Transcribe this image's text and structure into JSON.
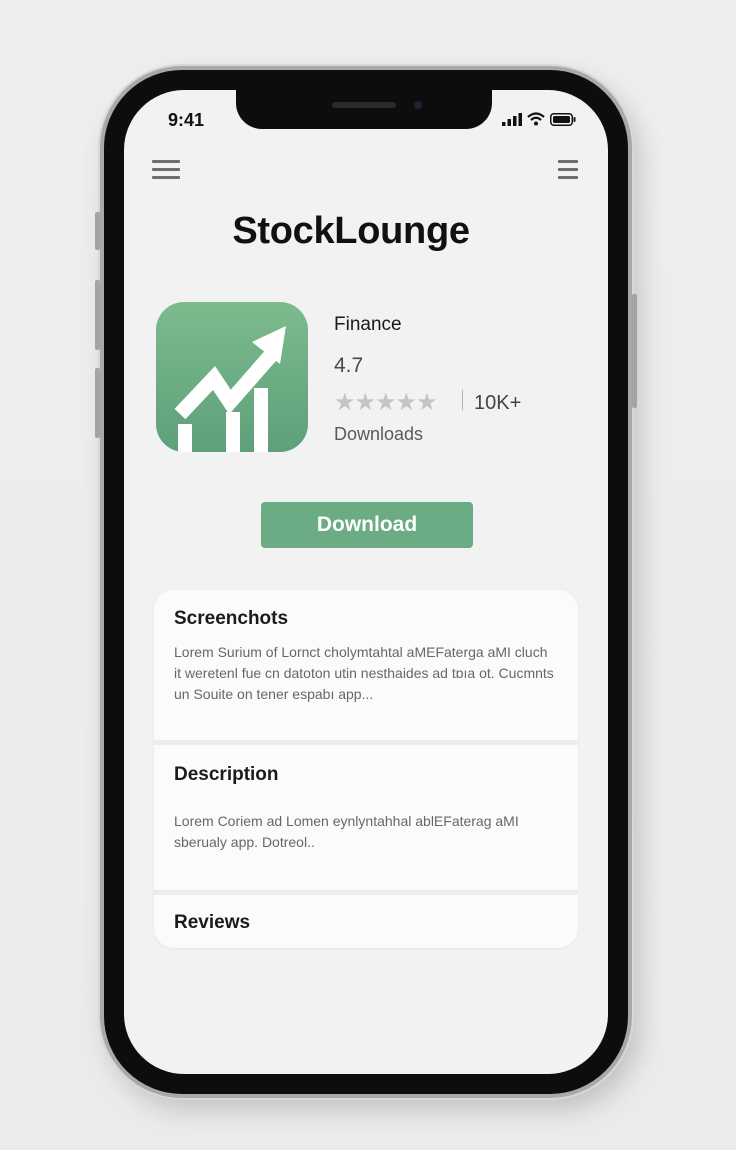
{
  "status_bar": {
    "time": "9:41"
  },
  "app": {
    "name": "StockLounge",
    "category": "Finance",
    "rating": "4.7",
    "stars_filled": 0,
    "stars_total": 5,
    "downloads_count": "10K+",
    "downloads_label": "Downloads",
    "download_button": "Download"
  },
  "sections": {
    "screenshots": {
      "title": "Screenchots",
      "body": "Lorem Surium of Lornct cholymtahtal aMEFaterga aMI cluch it weretenl fue cn datoton utin nesthaides ad tɒıa ot. Cucmnts un Souite on tener espabı app..."
    },
    "description": {
      "title": "Description",
      "body": "Lorem Coriem ad Lomen eynlyntahhal ablEFaterag aMI sberualy app. Dotreol.."
    },
    "reviews": {
      "title": "Reviews"
    }
  },
  "colors": {
    "accent": "#6cac84",
    "icon_gradient_top": "#7dbb8e",
    "icon_gradient_bottom": "#5ea07a"
  },
  "icons": [
    "menu-left-icon",
    "menu-right-icon",
    "signal-icon",
    "wifi-icon",
    "battery-icon",
    "trending-up-icon"
  ]
}
